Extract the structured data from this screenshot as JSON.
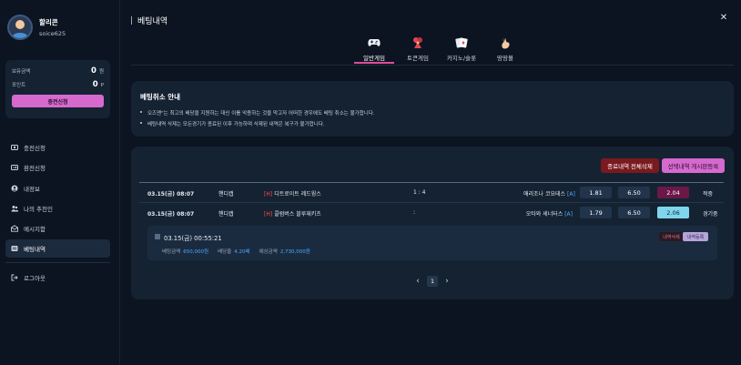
{
  "user": {
    "name": "할리콘",
    "id": "soice625"
  },
  "wallet": {
    "balance_label": "보유금액",
    "balance_value": "0",
    "balance_unit": "원",
    "points_label": "포인트",
    "points_value": "0",
    "points_unit": "P",
    "charge_label": "충전신청"
  },
  "nav": [
    {
      "label": "충전신청",
      "icon": "money-icon"
    },
    {
      "label": "환전신청",
      "icon": "exchange-icon"
    },
    {
      "label": "내정보",
      "icon": "user-icon"
    },
    {
      "label": "나의 추천인",
      "icon": "users-icon"
    },
    {
      "label": "메시지함",
      "icon": "mail-icon"
    },
    {
      "label": "베팅내역",
      "icon": "list-icon",
      "active": true
    }
  ],
  "logout_label": "로그아웃",
  "page_title": "베팅내역",
  "tabs": [
    {
      "label": "일반게임",
      "icon": "gamepad-icon",
      "active": true
    },
    {
      "label": "토큰게임",
      "icon": "token-icon"
    },
    {
      "label": "카지노/슬롯",
      "icon": "cards-icon"
    },
    {
      "label": "땅땅볼",
      "icon": "hand-icon"
    }
  ],
  "notice": {
    "title": "베팅취소 안내",
    "items": [
      "오즈맨\"는 최고의 배당을 지원하는 대신 이를 악용하는 것을 막고자 어떠한 경우에도 베팅 취소는 불가합니다.",
      "베팅내역 삭제는 모든경기가 종료된 이후 가능하며 삭제된 내역은 복구가 불가합니다."
    ]
  },
  "actions": {
    "delete_finished": "종료내역 전체삭제",
    "post_selected": "선택내역 게시판등록"
  },
  "bets": [
    {
      "time": "03.15(금) 08:07",
      "type": "핸디캡",
      "home_tag": "[H]",
      "home": "디트로이트 레드윙스",
      "score": "1 : 4",
      "away": "애리조나 코요테스",
      "away_tag": "[A]",
      "odds": [
        "1.81",
        "6.50",
        "2.04"
      ],
      "result": "적중"
    },
    {
      "time": "03.15(금) 08:07",
      "type": "핸디캡",
      "home_tag": "[H]",
      "home": "콜럼버스 블루재키츠",
      "score": ":",
      "away": "오타와 세너터스",
      "away_tag": "[A]",
      "odds": [
        "1.79",
        "6.50",
        "2.06"
      ],
      "result": "경기중"
    }
  ],
  "slip": {
    "date": "03.15(금) 00:55:21",
    "bet_amount_label": "베팅금액",
    "bet_amount": "650,000원",
    "odds_label": "배당율",
    "odds": "4.20배",
    "expected_label": "예상금액",
    "expected": "2,730,000원",
    "delete_label": "내역삭제",
    "register_label": "내역등록"
  },
  "pager": {
    "current": "1"
  }
}
